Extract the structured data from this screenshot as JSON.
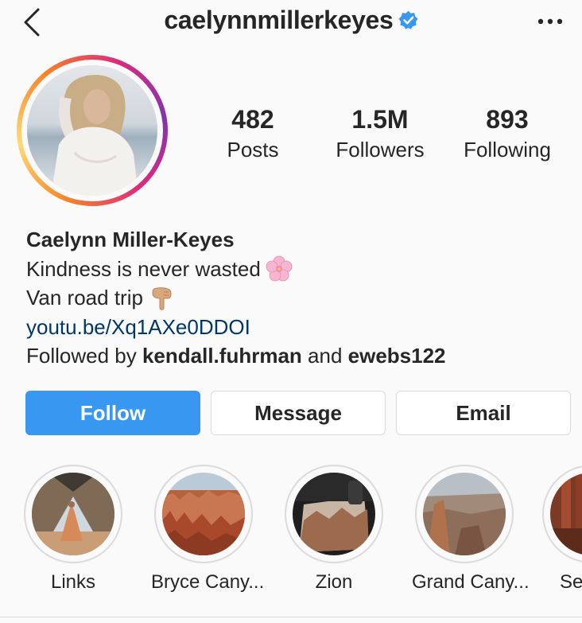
{
  "header": {
    "username": "caelynnmillerkeyes",
    "verified": true,
    "back_icon": "chevron-left-icon",
    "more_icon": "more-horizontal-icon"
  },
  "stats": [
    {
      "value": "482",
      "label": "Posts"
    },
    {
      "value": "1.5M",
      "label": "Followers"
    },
    {
      "value": "893",
      "label": "Following"
    }
  ],
  "bio": {
    "name": "Caelynn Miller-Keyes",
    "line1": "Kindness is never wasted",
    "line1_emoji": "cherry-blossom-emoji",
    "line2": "Van road trip",
    "line2_emoji": "pointing-down-emoji",
    "link": "youtu.be/Xq1AXe0DDOI",
    "followed_by_prefix": "Followed by",
    "followed_by_user1": "kendall.fuhrman",
    "followed_by_and": "and",
    "followed_by_user2": "ewebs122"
  },
  "buttons": {
    "follow": "Follow",
    "message": "Message",
    "email": "Email"
  },
  "highlights": [
    {
      "label": "Links"
    },
    {
      "label": "Bryce Cany..."
    },
    {
      "label": "Zion"
    },
    {
      "label": "Grand Cany..."
    },
    {
      "label": "Se"
    }
  ],
  "colors": {
    "follow_blue": "#3897f0",
    "link_blue": "#00376b",
    "verified_blue": "#3897f0"
  }
}
